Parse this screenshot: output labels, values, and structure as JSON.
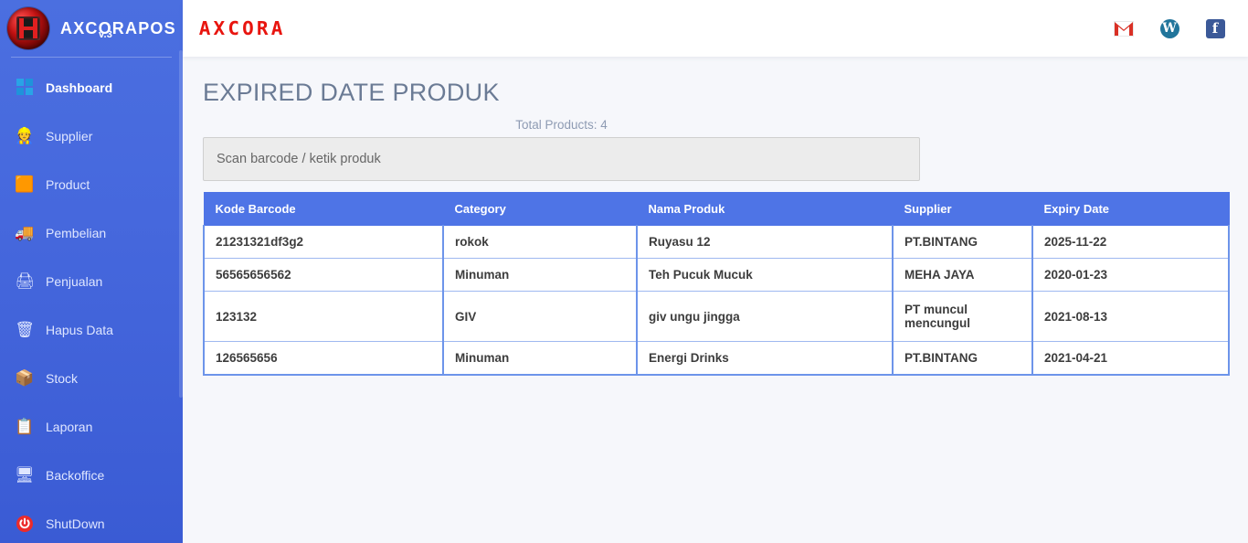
{
  "sidebar": {
    "brand": {
      "title": "AXCORAPOS",
      "version": "v.3",
      "logo_icon": "axcora-disc-logo"
    },
    "items": [
      {
        "label": "Dashboard",
        "icon": "windows-icon",
        "active": true
      },
      {
        "label": "Supplier",
        "icon": "supplier-worker-icon",
        "active": false
      },
      {
        "label": "Product",
        "icon": "package-box-icon",
        "active": false
      },
      {
        "label": "Pembelian",
        "icon": "delivery-truck-icon",
        "active": false
      },
      {
        "label": "Penjualan",
        "icon": "cash-register-icon",
        "active": false
      },
      {
        "label": "Hapus Data",
        "icon": "trash-bin-icon",
        "active": false
      },
      {
        "label": "Stock",
        "icon": "open-box-icon",
        "active": false
      },
      {
        "label": "Laporan",
        "icon": "clipboard-report-icon",
        "active": false
      },
      {
        "label": "Backoffice",
        "icon": "desktop-monitor-icon",
        "active": false
      },
      {
        "label": "ShutDown",
        "icon": "power-off-icon",
        "active": false
      }
    ]
  },
  "topbar": {
    "logo_text": "AXCORA",
    "icons": [
      {
        "name": "gmail-icon",
        "glyph": "M",
        "color": "#d93025"
      },
      {
        "name": "wordpress-icon",
        "glyph": "W",
        "color": "#21759b"
      },
      {
        "name": "facebook-icon",
        "glyph": "f",
        "color": "#3b5998"
      }
    ]
  },
  "page": {
    "title": "EXPIRED DATE PRODUK",
    "total_products_label": "Total Products: 4"
  },
  "search": {
    "value": "",
    "placeholder": "Scan barcode / ketik produk"
  },
  "table": {
    "columns": [
      "Kode Barcode",
      "Category",
      "Nama Produk",
      "Supplier",
      "Expiry Date"
    ],
    "rows": [
      {
        "kode_barcode": "21231321df3g2",
        "category": "rokok",
        "nama_produk": "Ruyasu 12",
        "supplier": "PT.BINTANG",
        "expiry_date": "2025-11-22"
      },
      {
        "kode_barcode": "56565656562",
        "category": "Minuman",
        "nama_produk": "Teh Pucuk Mucuk",
        "supplier": "MEHA JAYA",
        "expiry_date": "2020-01-23"
      },
      {
        "kode_barcode": "123132",
        "category": "GIV",
        "nama_produk": "giv ungu jingga",
        "supplier": "PT muncul mencungul",
        "expiry_date": "2021-08-13"
      },
      {
        "kode_barcode": "126565656",
        "category": "Minuman",
        "nama_produk": "Energi Drinks",
        "supplier": "PT.BINTANG",
        "expiry_date": "2021-04-21"
      }
    ]
  },
  "colors": {
    "sidebar_blue": "#4668dd",
    "table_header_blue": "#4e74e6",
    "table_border_blue": "#6d94ea",
    "brand_red": "#e8150f",
    "title_gray": "#6b7b95",
    "content_bg": "#f6f7fb"
  }
}
